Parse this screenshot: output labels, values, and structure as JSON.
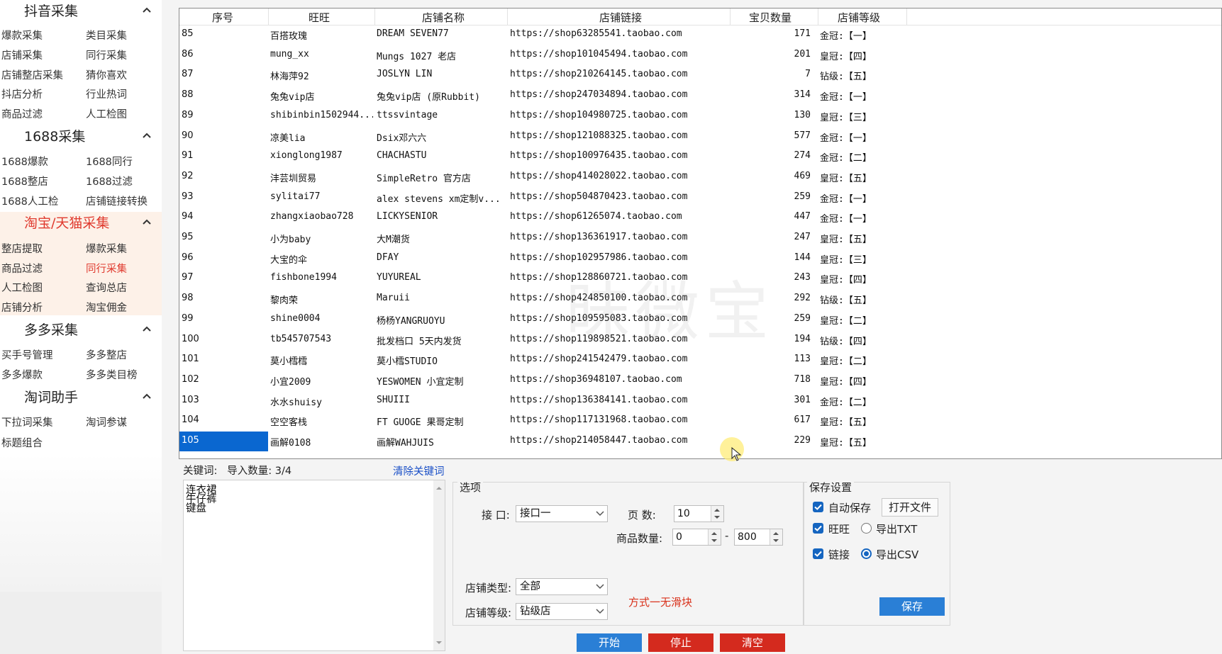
{
  "sidebar": {
    "groups": [
      {
        "title": "抖音采集",
        "items": [
          "爆款采集",
          "类目采集",
          "店铺采集",
          "同行采集",
          "店铺整店采集",
          "猜你喜欢",
          "抖店分析",
          "行业热词",
          "商品过滤",
          "人工检图"
        ]
      },
      {
        "title": "1688采集",
        "items": [
          "1688爆款",
          "1688同行",
          "1688整店",
          "1688过滤",
          "1688人工检",
          "店铺链接转换"
        ]
      },
      {
        "title": "淘宝/天猫采集",
        "items": [
          "整店提取",
          "爆款采集",
          "商品过滤",
          "同行采集",
          "人工检图",
          "查询总店",
          "店铺分析",
          "淘宝佣金"
        ]
      },
      {
        "title": "多多采集",
        "items": [
          "买手号管理",
          "多多整店",
          "多多爆款",
          "多多类目榜"
        ]
      },
      {
        "title": "淘词助手",
        "items": [
          "下拉词采集",
          "淘词参谋",
          "标题组合"
        ]
      }
    ]
  },
  "table": {
    "headers": [
      "序号",
      "旺旺",
      "店铺名称",
      "店铺链接",
      "宝贝数量",
      "店铺等级"
    ],
    "rows": [
      [
        "85",
        "百搭玫瑰",
        "DREAM SEVEN77",
        "https://shop63285541.taobao.com",
        "171",
        "金冠:【一】"
      ],
      [
        "86",
        "mung_xx",
        "Mungs 1027 老店",
        "https://shop101045494.taobao.com",
        "201",
        "皇冠:【四】"
      ],
      [
        "87",
        "林海萍92",
        "JOSLYN LIN",
        "https://shop210264145.taobao.com",
        "7",
        "钻级:【五】"
      ],
      [
        "88",
        "兔兔vip店",
        "兔兔vip店 (原Rubbit)",
        "https://shop247034894.taobao.com",
        "314",
        "金冠:【一】"
      ],
      [
        "89",
        "shibinbin1502944...",
        "ttssvintage",
        "https://shop104980725.taobao.com",
        "130",
        "皇冠:【三】"
      ],
      [
        "90",
        "凉美lia",
        "Dsix邓六六",
        "https://shop121088325.taobao.com",
        "577",
        "金冠:【一】"
      ],
      [
        "91",
        "xionglong1987",
        "CHACHASTU",
        "https://shop100976435.taobao.com",
        "274",
        "金冠:【二】"
      ],
      [
        "92",
        "沣芸圳贸易",
        "SimpleRetro 官方店",
        "https://shop414028022.taobao.com",
        "469",
        "皇冠:【五】"
      ],
      [
        "93",
        "sylitai77",
        "alex stevens  xm定制v...",
        "https://shop504870423.taobao.com",
        "259",
        "金冠:【一】"
      ],
      [
        "94",
        "zhangxiaobao728",
        "LICKYSENIOR",
        "https://shop61265074.taobao.com",
        "447",
        "金冠:【一】"
      ],
      [
        "95",
        "小为baby",
        "大M潮货",
        "https://shop136361917.taobao.com",
        "247",
        "皇冠:【五】"
      ],
      [
        "96",
        "大宝的伞",
        "DFAY",
        "https://shop102957986.taobao.com",
        "144",
        "皇冠:【三】"
      ],
      [
        "97",
        "fishbone1994",
        "YUYUREAL",
        "https://shop128860721.taobao.com",
        "243",
        "皇冠:【四】"
      ],
      [
        "98",
        "黎肉荣",
        "Maruii",
        "https://shop424850100.taobao.com",
        "292",
        "钻级:【五】"
      ],
      [
        "99",
        "shine0004",
        "杨杨YANGRUOYU",
        "https://shop109595083.taobao.com",
        "259",
        "皇冠:【二】"
      ],
      [
        "100",
        "tb545707543",
        "批发档口 5天内发货",
        "https://shop119898521.taobao.com",
        "194",
        "钻级:【四】"
      ],
      [
        "101",
        "莫小樰樰",
        "莫小樰STUDIO",
        "https://shop241542479.taobao.com",
        "113",
        "皇冠:【二】"
      ],
      [
        "102",
        "小宜2009",
        "YESWOMEN 小宜定制",
        "https://shop36948107.taobao.com",
        "718",
        "皇冠:【四】"
      ],
      [
        "103",
        "水水shuisy",
        "SHUIII",
        "https://shop136384141.taobao.com",
        "301",
        "金冠:【二】"
      ],
      [
        "104",
        "空空客栈",
        "FT GUOGE 果哥定制",
        "https://shop117131968.taobao.com",
        "617",
        "皇冠:【五】"
      ],
      [
        "105",
        "画解0108",
        "画解WAHJUIS",
        "https://shop214058447.taobao.com",
        "229",
        "皇冠:【五】"
      ]
    ],
    "selected_row_index": 20,
    "watermark": "昧微宝"
  },
  "keywords": {
    "label": "关键词:",
    "import_count": "导入数量: 3/4",
    "clear_label": "清除关键词",
    "list": [
      "连衣裙",
      "牛仔裤",
      "键盘"
    ]
  },
  "options": {
    "legend": "选项",
    "interface_label": "接 口:",
    "interface_value": "接口一",
    "pages_label": "页 数:",
    "pages_value": "10",
    "count_label": "商品数量:",
    "count_min": "0",
    "count_dash": "-",
    "count_max": "800",
    "shop_type_label": "店铺类型:",
    "shop_type_value": "全部",
    "shop_level_label": "店铺等级:",
    "shop_level_value": "钻级店",
    "method_text": "方式一无滑块"
  },
  "save": {
    "legend": "保存设置",
    "auto_save": "自动保存",
    "open_file": "打开文件",
    "wangwang": "旺旺",
    "export_txt": "导出TXT",
    "link": "链接",
    "export_csv": "导出CSV",
    "save_button": "保存"
  },
  "actions": {
    "start": "开始",
    "stop": "停止",
    "clear": "清空"
  },
  "colors": {
    "accent_red": "#e03a2e",
    "selected_blue": "#0a67d0",
    "button_blue": "#2a7fd6",
    "button_red": "#d42a1e"
  }
}
